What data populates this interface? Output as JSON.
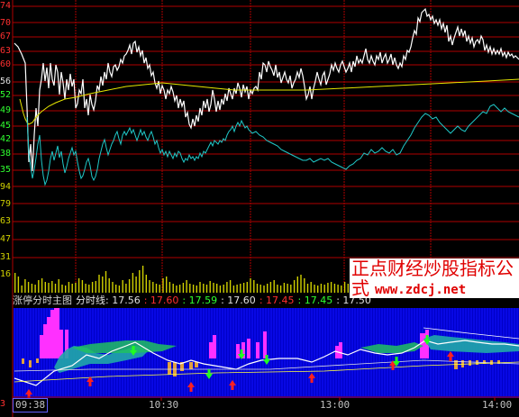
{
  "price_axis_labels": [
    {
      "text": "74",
      "color": "#ff3030"
    },
    {
      "text": "70",
      "color": "#ff3030"
    },
    {
      "text": "67",
      "color": "#ff3030"
    },
    {
      "text": "63",
      "color": "#ff3030"
    },
    {
      "text": "60",
      "color": "#ff3030"
    },
    {
      "text": "56",
      "color": "#e0e0e0"
    },
    {
      "text": "52",
      "color": "#30ff30"
    },
    {
      "text": "49",
      "color": "#30ff30"
    },
    {
      "text": "45",
      "color": "#30ff30"
    },
    {
      "text": "42",
      "color": "#30ff30"
    },
    {
      "text": "38",
      "color": "#30ff30"
    },
    {
      "text": "35",
      "color": "#30ff30"
    }
  ],
  "volume_axis_labels": [
    {
      "text": "94",
      "color": "#d0d000"
    },
    {
      "text": "79",
      "color": "#d0d000"
    },
    {
      "text": "63",
      "color": "#d0d000"
    },
    {
      "text": "47",
      "color": "#d0d000"
    },
    {
      "text": "31",
      "color": "#d0d000"
    },
    {
      "text": "16",
      "color": "#d0d000"
    }
  ],
  "info_bar": [
    {
      "text": "涨停分时主图",
      "color": "#d0d0d0"
    },
    {
      "text": "分时线: 17.56",
      "color": "#e0e0e0"
    },
    {
      "text": ": 17.60",
      "color": "#ff3030"
    },
    {
      "text": ": 17.59",
      "color": "#30ff30"
    },
    {
      "text": ": 17.60",
      "color": "#e0e0e0"
    },
    {
      "text": ": 17.45",
      "color": "#ff3030"
    },
    {
      "text": ": 17.45",
      "color": "#30ff30"
    },
    {
      "text": ": 17.50",
      "color": "#e0e0e0"
    }
  ],
  "lower_axis_label": {
    "text": "3",
    "color": "#ff3030"
  },
  "watermark": {
    "line1": "正点财经炒股指标公式",
    "line2": "www.zdcj.net"
  },
  "time_axis": {
    "start": "09:38",
    "ticks": [
      "10:30",
      "13:00",
      "14:00"
    ]
  },
  "colors": {
    "grid": "#b00000",
    "price_line": "#ffffff",
    "avg_line": "#e6e600",
    "cyan_line": "#20c8c8",
    "volume": "#d0d000",
    "panel_bg": "#0000c8"
  }
}
